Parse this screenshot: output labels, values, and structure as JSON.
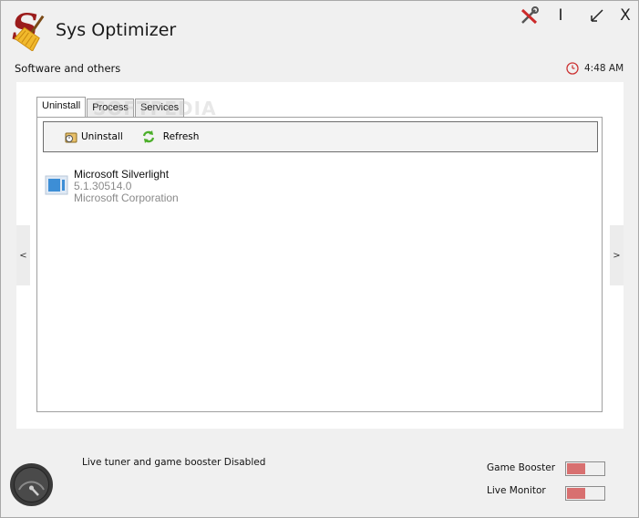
{
  "app": {
    "title": "Sys Optimizer",
    "logo_letter": "S"
  },
  "window_controls": {
    "tools_icon": "tools-icon",
    "minimize": "I",
    "restore_icon": "resize-arrow-icon",
    "close": "X"
  },
  "section": {
    "label": "Software and others"
  },
  "clock": {
    "time": "4:48 AM",
    "icon": "clock-icon"
  },
  "nav": {
    "prev": "<",
    "next": ">"
  },
  "tabs": [
    {
      "label": "Uninstall",
      "active": true
    },
    {
      "label": "Process",
      "active": false
    },
    {
      "label": "Services",
      "active": false
    }
  ],
  "watermark": "SOFTPEDIA",
  "toolbar": {
    "uninstall_label": "Uninstall",
    "refresh_label": "Refresh"
  },
  "software_list": [
    {
      "name": "Microsoft Silverlight",
      "version": "5.1.30514.0",
      "publisher": "Microsoft Corporation"
    }
  ],
  "footer": {
    "status": "Live tuner and game booster Disabled",
    "game_booster_label": "Game Booster",
    "live_monitor_label": "Live Monitor",
    "game_booster_on": false,
    "live_monitor_on": false,
    "toggle_color": "#d87070"
  }
}
